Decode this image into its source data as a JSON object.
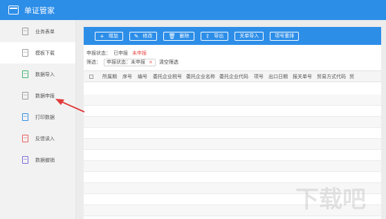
{
  "app": {
    "title": "单证管家"
  },
  "sidebar": {
    "items": [
      {
        "label": "业务表单",
        "icon": "form-icon"
      },
      {
        "label": "模板下载",
        "icon": "template-download-icon"
      },
      {
        "label": "数据导入",
        "icon": "data-import-icon"
      },
      {
        "label": "数据申报",
        "icon": "data-declare-icon"
      },
      {
        "label": "打印数据",
        "icon": "printer-icon"
      },
      {
        "label": "反馈读入",
        "icon": "feedback-icon"
      },
      {
        "label": "数据撤销",
        "icon": "data-revoke-icon"
      }
    ]
  },
  "toolbar": {
    "buttons": [
      {
        "label": "增加",
        "icon": "+"
      },
      {
        "label": "修改",
        "icon": "✎"
      },
      {
        "label": "删除",
        "icon": "🗑"
      },
      {
        "label": "导出",
        "icon": "⇪"
      },
      {
        "label": "关单导入",
        "icon": ""
      },
      {
        "label": "项号重排",
        "icon": ""
      }
    ]
  },
  "status": {
    "label": "申报状态：",
    "options": [
      "已申报",
      "未申报"
    ]
  },
  "filter": {
    "label": "筛选：",
    "chip": "申报状态：未申报",
    "chip_close": "×",
    "clear": "清空筛选"
  },
  "table": {
    "columns": [
      "所属期",
      "序号",
      "编号",
      "委托企业税号",
      "委托企业名称",
      "委托企业代码",
      "项号",
      "出口日期",
      "报关单号",
      "贸易方式代码",
      "贸"
    ]
  },
  "watermark": {
    "text": "下载吧"
  },
  "colors": {
    "accent": "#2d8ee8",
    "alert": "#e84a4a"
  }
}
